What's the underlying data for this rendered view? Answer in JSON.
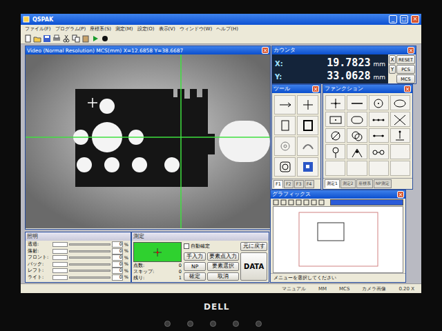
{
  "monitor": {
    "brand": "DELL"
  },
  "window": {
    "title": "QSPAK",
    "controls": [
      "_",
      "□",
      "×"
    ]
  },
  "menu": [
    "ファイル(F)",
    "プログラム(P)",
    "座標系(S)",
    "測定(M)",
    "設定(O)",
    "表示(V)",
    "ウィンドウ(W)",
    "ヘルプ(H)"
  ],
  "video": {
    "title": "Video (Normal Resolution)  MCS(mm) X=12.6858 Y=38.6687",
    "close": "×"
  },
  "counter": {
    "title": "カウンタ",
    "close": "×",
    "rows": [
      {
        "axis": "X:",
        "value": "19.7823",
        "unit": "mm"
      },
      {
        "axis": "Y:",
        "value": "33.0628",
        "unit": "mm"
      }
    ],
    "axis_buttons": [
      "X",
      "Y"
    ],
    "mode_buttons": [
      "RESET",
      "PCS",
      "MCS"
    ]
  },
  "tool": {
    "title": "ツール",
    "close": "×",
    "tabs": [
      {
        "label": "F1",
        "selected": true
      },
      {
        "label": "F2",
        "selected": false
      },
      {
        "label": "F3",
        "selected": false
      },
      {
        "label": "F4",
        "selected": false
      }
    ]
  },
  "function": {
    "title": "ファンクション",
    "close": "×",
    "tabs": [
      {
        "label": "測定1",
        "selected": true
      },
      {
        "label": "測定2",
        "selected": false
      },
      {
        "label": "座標系",
        "selected": false
      },
      {
        "label": "NP測定",
        "selected": false
      }
    ]
  },
  "graphics": {
    "title": "グラフィックス",
    "close": "×",
    "message": "メニューを選択してください"
  },
  "lighting": {
    "title": "照明",
    "rows": [
      {
        "label": "透過:",
        "value": "0",
        "unit": "%"
      },
      {
        "label": "落射:",
        "value": "0",
        "unit": "%"
      },
      {
        "label": "フロント:",
        "value": "0",
        "unit": "%"
      },
      {
        "label": "バック:",
        "value": "0",
        "unit": "%"
      },
      {
        "label": "レフト:",
        "value": "0",
        "unit": "%"
      },
      {
        "label": "ライト:",
        "value": "0",
        "unit": "%"
      }
    ]
  },
  "measure": {
    "title": "測定",
    "auto_confirm": {
      "label": "自動確定",
      "checked": false
    },
    "counts": [
      {
        "label": "点数:",
        "value": "0"
      },
      {
        "label": "スキップ:",
        "value": "0"
      },
      {
        "label": "残り:",
        "value": "1"
      }
    ],
    "undo": "元に戻す",
    "manual": "手入力",
    "point_input": "要素点入力",
    "np": "NP",
    "select": "要素選択",
    "confirm": "確定",
    "cancel": "取消",
    "data": "DATA"
  },
  "status_bar": [
    "マニュアル",
    "MM",
    "MCS",
    "カメラ画像",
    "0.20 X"
  ]
}
